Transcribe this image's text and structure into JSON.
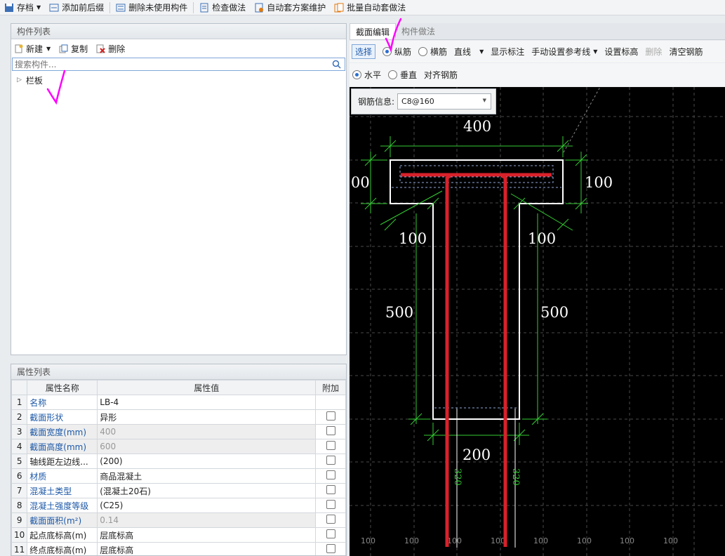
{
  "toolbar": {
    "save": "存档",
    "add_prefix_suffix": "添加前后缀",
    "delete_unused": "删除未使用构件",
    "check_method": "检查做法",
    "auto_plan_maintain": "自动套方案维护",
    "batch_auto_apply": "批量自动套做法"
  },
  "component_list": {
    "title": "构件列表",
    "new_label": "新建",
    "copy_label": "复制",
    "delete_label": "删除",
    "search_placeholder": "搜索构件...",
    "tree_item": "栏板"
  },
  "property_list": {
    "title": "属性列表",
    "headers": {
      "name": "属性名称",
      "value": "属性值",
      "extra": "附加"
    },
    "rows": [
      {
        "num": "1",
        "name": "名称",
        "value": "LB-4"
      },
      {
        "num": "2",
        "name": "截面形状",
        "value": "异形"
      },
      {
        "num": "3",
        "name": "截面宽度(mm)",
        "value": "400"
      },
      {
        "num": "4",
        "name": "截面高度(mm)",
        "value": "600"
      },
      {
        "num": "5",
        "name": "轴线距左边线...",
        "value": "(200)"
      },
      {
        "num": "6",
        "name": "材质",
        "value": "商品混凝土"
      },
      {
        "num": "7",
        "name": "混凝土类型",
        "value": "(混凝土20石)"
      },
      {
        "num": "8",
        "name": "混凝土强度等级",
        "value": "(C25)"
      },
      {
        "num": "9",
        "name": "截面面积(m²)",
        "value": "0.14"
      },
      {
        "num": "10",
        "name": "起点底标高(m)",
        "value": "层底标高"
      },
      {
        "num": "11",
        "name": "终点底标高(m)",
        "value": "层底标高"
      }
    ]
  },
  "editor": {
    "tabs": [
      "截面编辑",
      "构件做法"
    ],
    "select": "选择",
    "longitudinal": "纵筋",
    "transverse": "横筋",
    "line_mode": "直线",
    "show_annotation": "显示标注",
    "manual_reference": "手动设置参考线",
    "set_elevation": "设置标高",
    "delete": "删除",
    "clear_rebar": "清空钢筋",
    "horizontal": "水平",
    "vertical": "垂直",
    "align_rebar": "对齐钢筋"
  },
  "canvas": {
    "rebar_info_label": "钢筋信息:",
    "rebar_value": "C8@160",
    "dims": {
      "top_width": "400",
      "left_height_clipped": "00",
      "right_height": "100",
      "flange_left": "100",
      "flange_right": "100",
      "web_left": "500",
      "web_right": "500",
      "bottom_width": "200",
      "rebar_len_left": "320",
      "rebar_len_right": "320"
    },
    "grid_labels": [
      "100",
      "100",
      "100",
      "100",
      "100",
      "100",
      "100",
      "100"
    ],
    "colors": {
      "rebar": "#d9212a",
      "dimension": "#33cc33",
      "outline": "#ffffff",
      "grid": "#4a4a4a",
      "annotation": "#ff00ff"
    }
  }
}
